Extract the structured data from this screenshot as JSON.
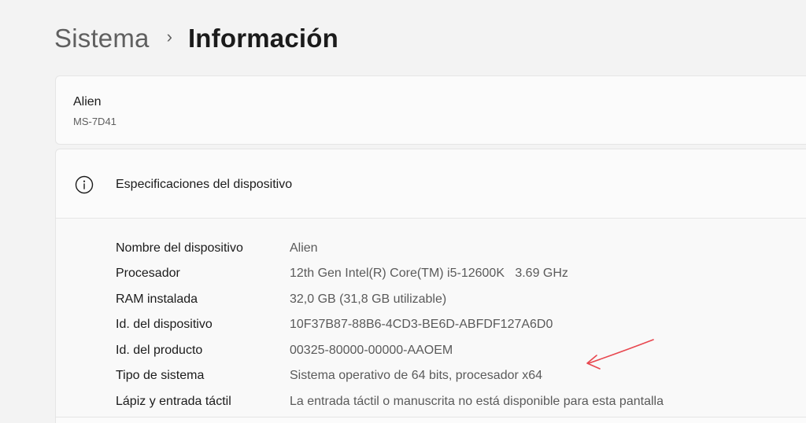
{
  "breadcrumb": {
    "parent": "Sistema",
    "separator": "›",
    "current": "Información"
  },
  "device": {
    "name": "Alien",
    "model": "MS-7D41"
  },
  "specs": {
    "title": "Especificaciones del dispositivo",
    "icon": "info-icon",
    "rows": [
      {
        "label": "Nombre del dispositivo",
        "value": "Alien"
      },
      {
        "label": "Procesador",
        "value": "12th Gen Intel(R) Core(TM) i5-12600K   3.69 GHz"
      },
      {
        "label": "RAM instalada",
        "value": "32,0 GB (31,8 GB utilizable)"
      },
      {
        "label": "Id. del dispositivo",
        "value": "10F37B87-88B6-4CD3-BE6D-ABFDF127A6D0"
      },
      {
        "label": "Id. del producto",
        "value": "00325-80000-00000-AAOEM"
      },
      {
        "label": "Tipo de sistema",
        "value": "Sistema operativo de 64 bits, procesador x64"
      },
      {
        "label": "Lápiz y entrada táctil",
        "value": "La entrada táctil o manuscrita no está disponible para esta pantalla"
      }
    ]
  },
  "colors": {
    "background": "#f3f3f3",
    "card": "#fbfbfb",
    "annotation_arrow": "#e8474f"
  }
}
